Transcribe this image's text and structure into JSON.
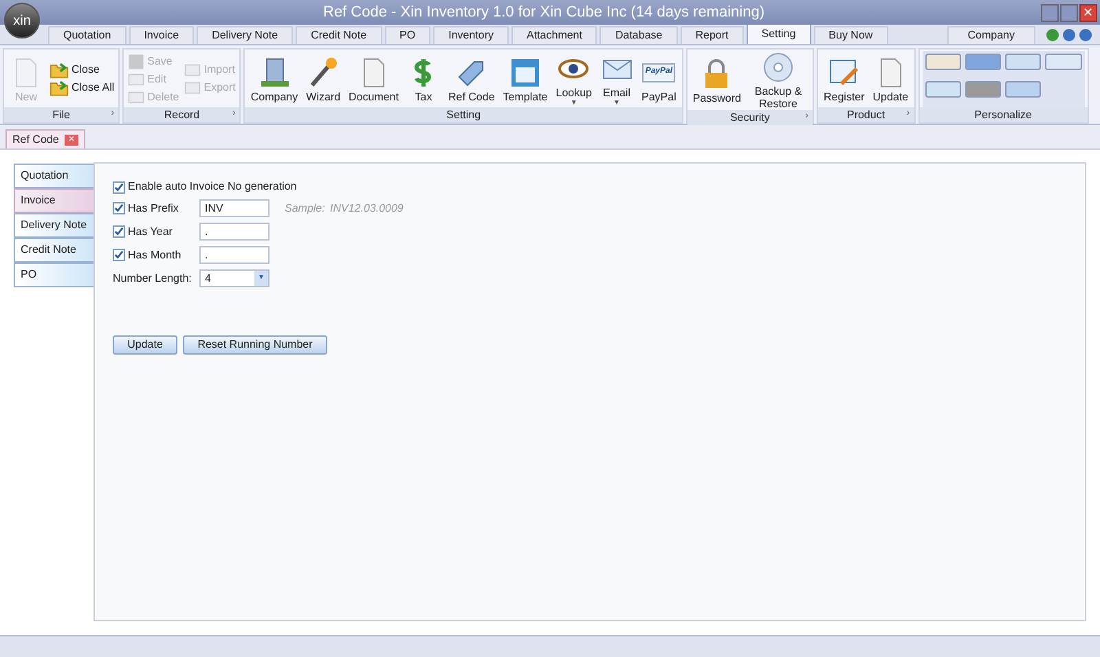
{
  "window": {
    "title": "Ref Code - Xin Inventory 1.0 for Xin Cube Inc (14 days remaining)",
    "logo": "xin",
    "close_glyph": "✕"
  },
  "menu_tabs": [
    {
      "label": "Quotation",
      "selected": false
    },
    {
      "label": "Invoice",
      "selected": false
    },
    {
      "label": "Delivery Note",
      "selected": false
    },
    {
      "label": "Credit Note",
      "selected": false
    },
    {
      "label": "PO",
      "selected": false
    },
    {
      "label": "Inventory",
      "selected": false
    },
    {
      "label": "Attachment",
      "selected": false
    },
    {
      "label": "Database",
      "selected": false
    },
    {
      "label": "Report",
      "selected": false
    },
    {
      "label": "Setting",
      "selected": true
    },
    {
      "label": "Buy Now",
      "selected": false
    }
  ],
  "company_tab": "Company",
  "ribbon": [
    {
      "label": "File",
      "kind": "buttons",
      "launcher": "›",
      "columns": [
        [
          {
            "label": "New",
            "kind": "large",
            "disabled": true
          }
        ],
        [
          {
            "label": "Close",
            "kind": "small",
            "disabled": false
          },
          {
            "label": "Close All",
            "kind": "small",
            "disabled": false
          }
        ]
      ]
    },
    {
      "label": "Record",
      "kind": "buttons",
      "launcher": "›",
      "columns": [
        [
          {
            "label": "Save",
            "kind": "small",
            "disabled": true
          },
          {
            "label": "Edit",
            "kind": "small",
            "disabled": true
          },
          {
            "label": "Delete",
            "kind": "small",
            "disabled": true
          }
        ],
        [
          {
            "label": "Import",
            "kind": "small",
            "disabled": true
          },
          {
            "label": "Export",
            "kind": "small",
            "disabled": true
          }
        ]
      ]
    },
    {
      "label": "Setting",
      "kind": "buttons",
      "columns": [
        [
          {
            "label": "Company",
            "kind": "large",
            "disabled": false
          }
        ],
        [
          {
            "label": "Wizard",
            "kind": "large",
            "disabled": false
          }
        ],
        [
          {
            "label": "Document",
            "kind": "large",
            "disabled": false
          }
        ],
        [
          {
            "label": "Tax",
            "kind": "large",
            "disabled": false
          }
        ],
        [
          {
            "label": "Ref Code",
            "kind": "large",
            "disabled": false
          }
        ],
        [
          {
            "label": "Template",
            "kind": "large",
            "disabled": false
          }
        ],
        [
          {
            "label": "Lookup",
            "kind": "large",
            "disabled": false,
            "dropdown": "▼"
          }
        ],
        [
          {
            "label": "Email",
            "kind": "large",
            "disabled": false,
            "dropdown": "▼"
          }
        ],
        [
          {
            "label": "PayPal",
            "kind": "large",
            "disabled": false,
            "icon_text": "PayPal"
          }
        ]
      ]
    },
    {
      "label": "Security",
      "kind": "buttons",
      "launcher": "›",
      "columns": [
        [
          {
            "label": "Password",
            "kind": "large",
            "disabled": false
          }
        ],
        [
          {
            "label": "Backup & Restore",
            "kind": "large",
            "disabled": false
          }
        ]
      ]
    },
    {
      "label": "Product",
      "kind": "buttons",
      "launcher": "›",
      "columns": [
        [
          {
            "label": "Register",
            "kind": "large",
            "disabled": false
          }
        ],
        [
          {
            "label": "Update",
            "kind": "large",
            "disabled": false
          }
        ]
      ]
    },
    {
      "label": "Personalize",
      "kind": "gallery"
    }
  ],
  "document_tab": {
    "label": "Ref Code",
    "close_glyph": "✕"
  },
  "side_tabs": [
    {
      "label": "Quotation",
      "selected": false
    },
    {
      "label": "Invoice",
      "selected": true
    },
    {
      "label": "Delivery Note",
      "selected": false
    },
    {
      "label": "Credit Note",
      "selected": false
    },
    {
      "label": "PO",
      "selected": false
    }
  ],
  "form": {
    "enable": {
      "label": "Enable auto Invoice No generation",
      "checked": true
    },
    "fields": [
      {
        "label": "Has Prefix",
        "checked": true,
        "value": "INV"
      },
      {
        "label": "Has Year",
        "checked": true,
        "value": "."
      },
      {
        "label": "Has Month",
        "checked": true,
        "value": "."
      }
    ],
    "sample_label": "Sample:",
    "sample_value": "INV12.03.0009",
    "number_length": {
      "label": "Number Length:",
      "value": "4",
      "arrow": "▼"
    },
    "buttons": [
      "Update",
      "Reset Running Number"
    ]
  }
}
